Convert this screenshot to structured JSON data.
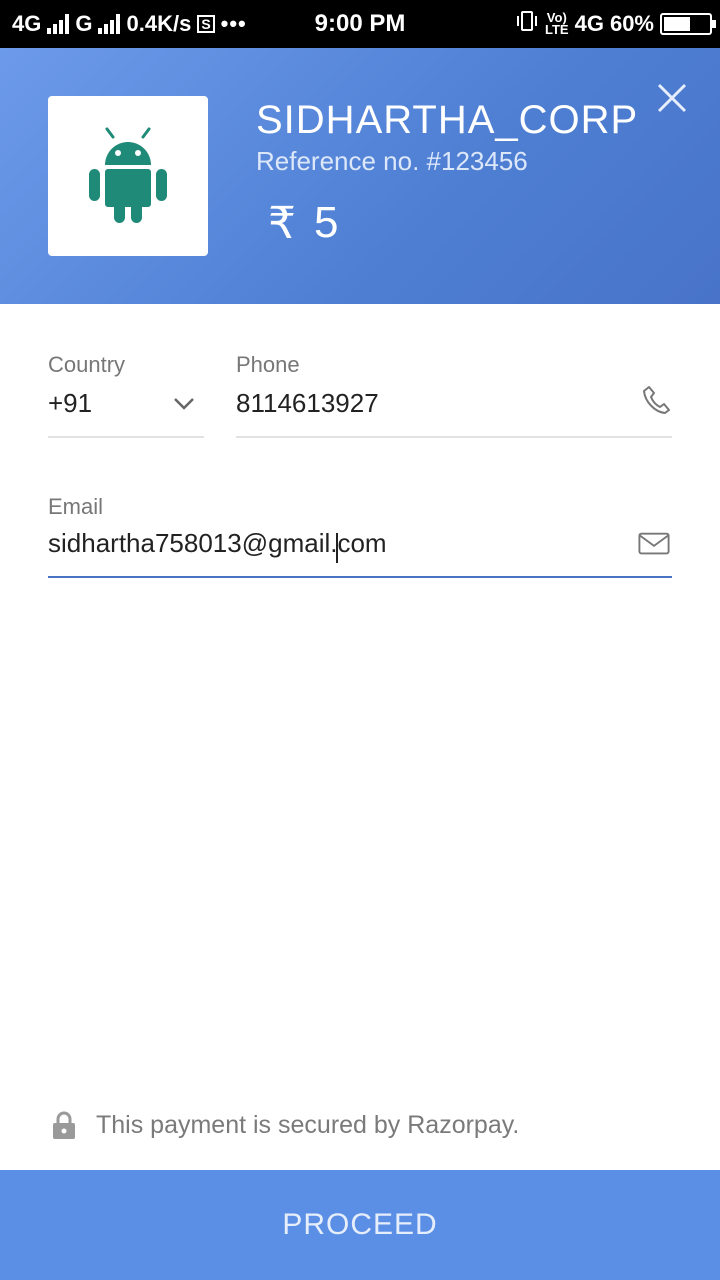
{
  "status_bar": {
    "network1": "4G",
    "network2": "G",
    "speed": "0.4K/s",
    "sim_icon_text": "S",
    "more": "•••",
    "time": "9:00 PM",
    "volte_top": "Vo)",
    "volte_bottom": "LTE",
    "network3": "4G",
    "battery": "60%",
    "battery_level": 0.6
  },
  "header": {
    "merchant_name": "SIDHARTHA_CORP",
    "reference": "Reference no. #123456",
    "currency_symbol": "₹",
    "amount": "5",
    "logo_icon": "android-icon",
    "close_icon": "close-icon",
    "colors": {
      "gradient_start": "#6d9aea",
      "gradient_end": "#4873c8",
      "android_green": "#1f8a77"
    }
  },
  "form": {
    "country": {
      "label": "Country",
      "value": "+91",
      "icon": "chevron-down-icon"
    },
    "phone": {
      "label": "Phone",
      "value": "8114613927",
      "icon": "phone-icon"
    },
    "email": {
      "label": "Email",
      "value_before_caret": "sidhartha758013@gmail.",
      "value_after_caret": "com",
      "icon": "mail-icon"
    }
  },
  "footer": {
    "secure_text": "This payment is secured by Razorpay.",
    "lock_icon": "lock-icon",
    "proceed_label": "PROCEED",
    "colors": {
      "proceed_bg": "#5b8fe6",
      "accent": "#4a72c2"
    }
  }
}
